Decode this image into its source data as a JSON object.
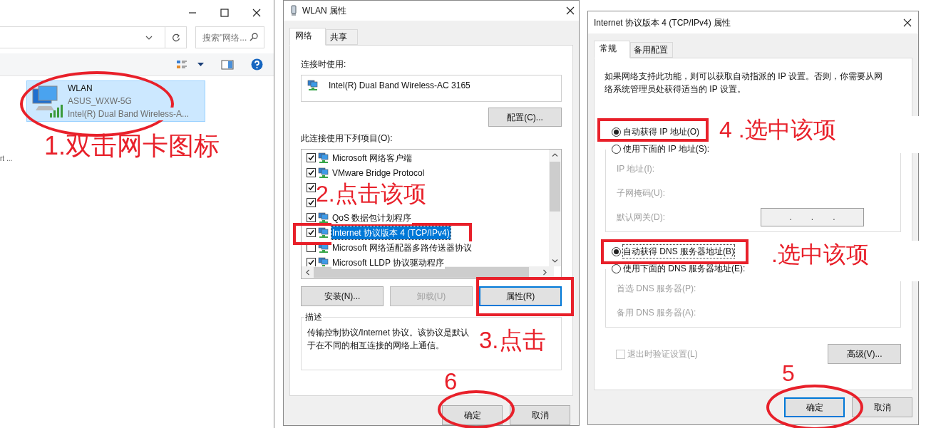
{
  "explorer": {
    "search": {
      "placeholder": "搜索\"网络..."
    },
    "items": [
      {
        "name": "WLAN",
        "network": "ASUS_WXW-5G",
        "adapter": "Intel(R) Dual Band Wireless-A...",
        "selected": true
      }
    ],
    "cut_text": "rt ..."
  },
  "wlan_dialog": {
    "title": "WLAN 属性",
    "tabs": [
      {
        "label": "网络",
        "selected": true
      },
      {
        "label": "共享",
        "selected": false
      }
    ],
    "connect_using_label": "连接时使用:",
    "adapter": "Intel(R) Dual Band Wireless-AC 3165",
    "configure_button": "配置(C)...",
    "items_label": "此连接使用下列项目(O):",
    "items": [
      {
        "label": "Microsoft 网络客户端",
        "checked": true,
        "selected": false
      },
      {
        "label": "VMware Bridge Protocol",
        "checked": true,
        "selected": false
      },
      {
        "checked": true,
        "selected": false
      },
      {
        "checked": true,
        "selected": false
      },
      {
        "label": "QoS 数据包计划程序",
        "checked": true,
        "selected": false
      },
      {
        "label": "Internet 协议版本 4 (TCP/IPv4)",
        "checked": true,
        "selected": true
      },
      {
        "label": "Microsoft 网络适配器多路传送器协议",
        "checked": false,
        "selected": false
      },
      {
        "label": "Microsoft LLDP 协议驱动程序",
        "checked": true,
        "selected": false
      }
    ],
    "buttons": [
      {
        "label": "安装(N)...",
        "disabled": false,
        "focused": false
      },
      {
        "label": "卸载(U)",
        "disabled": true,
        "focused": false
      },
      {
        "label": "属性(R)",
        "disabled": false,
        "focused": true
      }
    ],
    "description_label": "描述",
    "description_lines": [
      "传输控制协议/Internet 协议。该协议是默认",
      "于在不同的相互连接的网络上通信。"
    ],
    "footer_buttons": [
      {
        "label": "确定",
        "focused": false
      },
      {
        "label": "取消",
        "focused": false
      }
    ]
  },
  "ipv4_dialog": {
    "title": "Internet 协议版本 4 (TCP/IPv4) 属性",
    "tabs": [
      {
        "label": "常规",
        "selected": true
      },
      {
        "label": "备用配置",
        "selected": false
      }
    ],
    "intro": "如果网络支持此功能，则可以获取自动指派的 IP 设置。否则，你需要从网络系统管理员处获得适当的 IP 设置。",
    "ip_options": [
      {
        "label": "自动获得 IP 地址(O)",
        "selected": true
      },
      {
        "label": "使用下面的 IP 地址(S):",
        "selected": false
      }
    ],
    "ip_fields": [
      {
        "label": "IP 地址(I):",
        "disabled": true
      },
      {
        "label": "子网掩码(U):",
        "disabled": true
      },
      {
        "label": "默认网关(D):",
        "disabled": true,
        "ip_value": [
          ".",
          ".",
          "."
        ]
      }
    ],
    "dns_options": [
      {
        "label": "自动获得 DNS 服务器地址(B)",
        "selected": true,
        "focused": true
      },
      {
        "label": "使用下面的 DNS 服务器地址(E):",
        "selected": false
      }
    ],
    "dns_fields": [
      {
        "label": "首选 DNS 服务器(P):",
        "disabled": true
      },
      {
        "label": "备用 DNS 服务器(A):",
        "disabled": true
      }
    ],
    "validate": {
      "label": "退出时验证设置(L)",
      "checked": false,
      "disabled": true
    },
    "advanced_button": "高级(V)...",
    "footer_buttons": [
      {
        "label": "确定",
        "focused": true
      },
      {
        "label": "取消",
        "focused": false
      }
    ]
  },
  "annotations": [
    {
      "text": "1.双击网卡图标"
    },
    {
      "text": "2.点击该项"
    },
    {
      "text": "3.点击"
    },
    {
      "text": "6"
    },
    {
      "text": "4 .选中该项"
    },
    {
      "text": ".选中该项"
    },
    {
      "text": "5"
    }
  ]
}
